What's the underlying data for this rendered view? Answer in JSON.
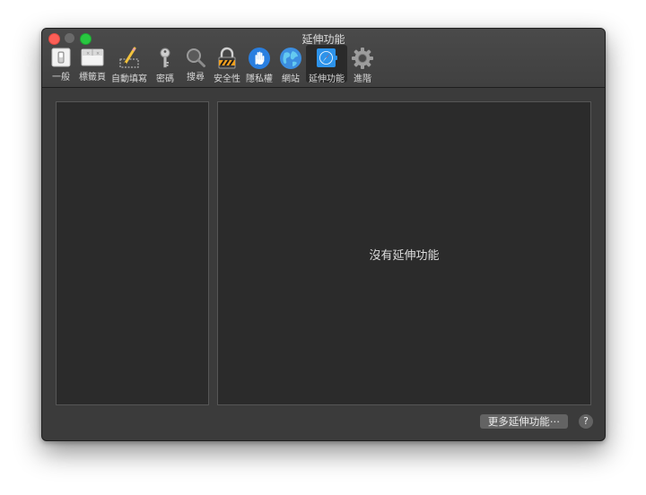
{
  "window": {
    "title": "延伸功能"
  },
  "toolbar": {
    "items": [
      {
        "label": "一般",
        "icon": "general-switch-icon"
      },
      {
        "label": "標籤頁",
        "icon": "tabs-icon"
      },
      {
        "label": "自動填寫",
        "icon": "pencil-autofill-icon"
      },
      {
        "label": "密碼",
        "icon": "key-icon"
      },
      {
        "label": "搜尋",
        "icon": "magnifier-icon"
      },
      {
        "label": "安全性",
        "icon": "padlock-icon"
      },
      {
        "label": "隱私權",
        "icon": "hand-icon"
      },
      {
        "label": "網站",
        "icon": "globe-icon"
      },
      {
        "label": "延伸功能",
        "icon": "extensions-icon"
      },
      {
        "label": "進階",
        "icon": "gear-icon"
      }
    ],
    "active_index": 8
  },
  "content": {
    "empty_message": "沒有延伸功能"
  },
  "footer": {
    "more_button": "更多延伸功能⋯",
    "help_button": "?"
  },
  "colors": {
    "close": "#fc5f57",
    "zoom": "#28c840",
    "window_bg": "#3b3b3b",
    "panel_bg": "#2b2b2b"
  }
}
